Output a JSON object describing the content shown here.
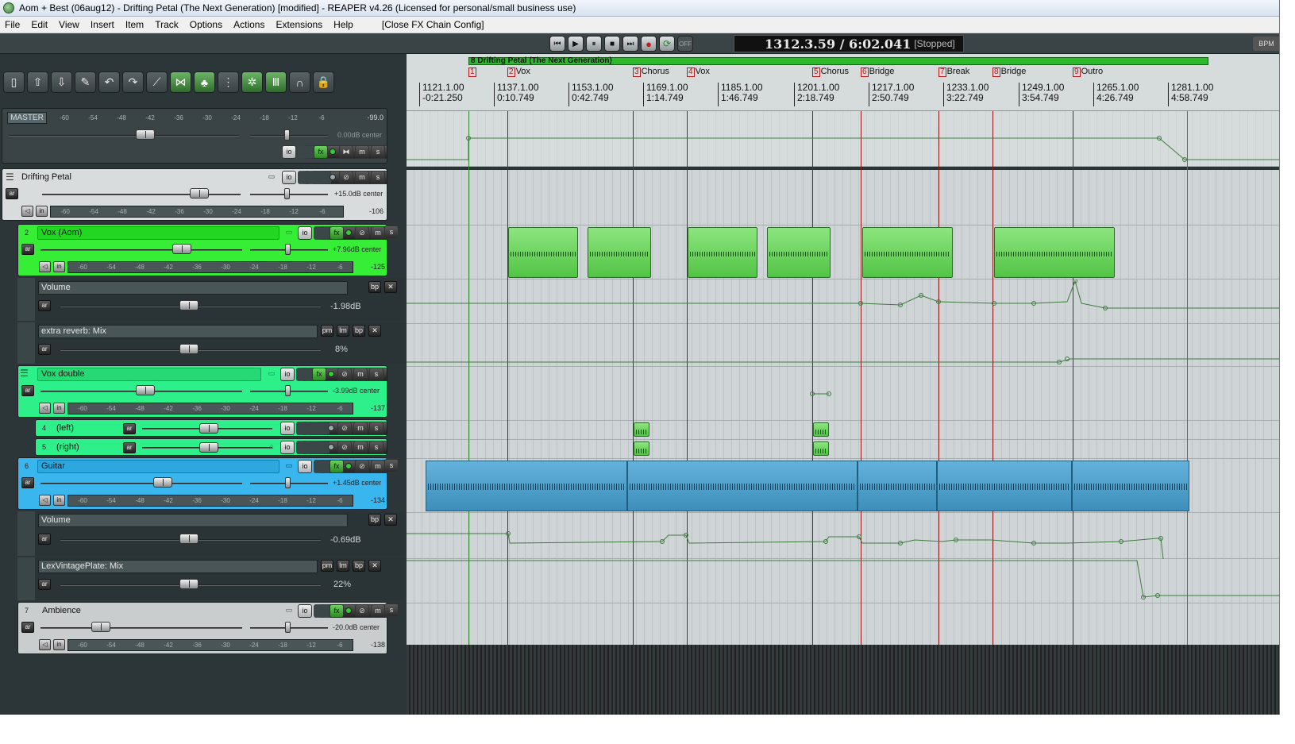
{
  "window": {
    "title": "Aom + Best (06aug12) - Drifting Petal (The Next Generation) [modified] - REAPER v4.26 (Licensed for personal/small business use)"
  },
  "menu": {
    "items": [
      "File",
      "Edit",
      "View",
      "Insert",
      "Item",
      "Track",
      "Options",
      "Actions",
      "Extensions",
      "Help"
    ],
    "fx_chain": "[Close FX Chain Config]"
  },
  "transport": {
    "position": "1312.3.59 / 6:02.041",
    "state": "[Stopped]",
    "off_label": "OFF",
    "bpm_label": "BPM"
  },
  "master": {
    "name": "MASTER",
    "meter_ticks": [
      "-60",
      "-54",
      "-48",
      "-42",
      "-36",
      "-30",
      "-24",
      "-18",
      "-12",
      "-6"
    ],
    "peak": "-99.0",
    "vol_pan": "0.00dB center"
  },
  "tracks": [
    {
      "num": "",
      "name": "Drifting Petal",
      "vol_pan": "+15.0dB center",
      "peak": "-106",
      "color": "#d9dcdc"
    },
    {
      "num": "2",
      "name": "Vox (Aom)",
      "vol_pan": "+7.96dB center",
      "peak": "-125",
      "color": "#36ee36"
    },
    {
      "num": "",
      "name": "Vox double",
      "vol_pan": "-3.99dB center",
      "peak": "-137",
      "color": "#2ef08a"
    },
    {
      "num": "4",
      "name": "(left)"
    },
    {
      "num": "5",
      "name": "(right)"
    },
    {
      "num": "6",
      "name": "Guitar",
      "vol_pan": "+1.45dB center",
      "peak": "-134",
      "color": "#3ab6ee"
    },
    {
      "num": "7",
      "name": "Ambience",
      "vol_pan": "-20.0dB center",
      "peak": "-138",
      "color": "#c9cdcd"
    }
  ],
  "envelopes": {
    "vox_volume": {
      "name": "Volume",
      "value": "-1.98dB"
    },
    "vox_reverb": {
      "name": "extra reverb: Mix",
      "value": "8%"
    },
    "guitar_volume": {
      "name": "Volume",
      "value": "-0.69dB"
    },
    "guitar_plate": {
      "name": "LexVintagePlate: Mix",
      "value": "22%"
    }
  },
  "buttons": {
    "io": "io",
    "env": "env",
    "fx": "fx",
    "m": "m",
    "s": "s",
    "ar": "ar",
    "in": "in",
    "pm": "pm",
    "lm": "lm",
    "bp": "bp",
    "x": "✕"
  },
  "timeline": {
    "region": "8  Drifting Petal (The Next Generation)",
    "markers": [
      {
        "num": "1",
        "label": ""
      },
      {
        "num": "2",
        "label": "Vox"
      },
      {
        "num": "3",
        "label": "Chorus"
      },
      {
        "num": "4",
        "label": "Vox"
      },
      {
        "num": "5",
        "label": "Chorus"
      },
      {
        "num": "6",
        "label": "Bridge"
      },
      {
        "num": "7",
        "label": "Break"
      },
      {
        "num": "8",
        "label": "Bridge"
      },
      {
        "num": "9",
        "label": "Outro"
      }
    ],
    "ruler": [
      {
        "bar": "1121.1.00",
        "time": "-0:21.250"
      },
      {
        "bar": "1137.1.00",
        "time": "0:10.749"
      },
      {
        "bar": "1153.1.00",
        "time": "0:42.749"
      },
      {
        "bar": "1169.1.00",
        "time": "1:14.749"
      },
      {
        "bar": "1185.1.00",
        "time": "1:46.749"
      },
      {
        "bar": "1201.1.00",
        "time": "2:18.749"
      },
      {
        "bar": "1217.1.00",
        "time": "2:50.749"
      },
      {
        "bar": "1233.1.00",
        "time": "3:22.749"
      },
      {
        "bar": "1249.1.00",
        "time": "3:54.749"
      },
      {
        "bar": "1265.1.00",
        "time": "4:26.749"
      },
      {
        "bar": "1281.1.00",
        "time": "4:58.749"
      }
    ]
  },
  "colors": {
    "vox": "#52c445",
    "guitar": "#3e8ebb",
    "marker_line": "#8b1a1a",
    "region": "#2eb82e"
  }
}
